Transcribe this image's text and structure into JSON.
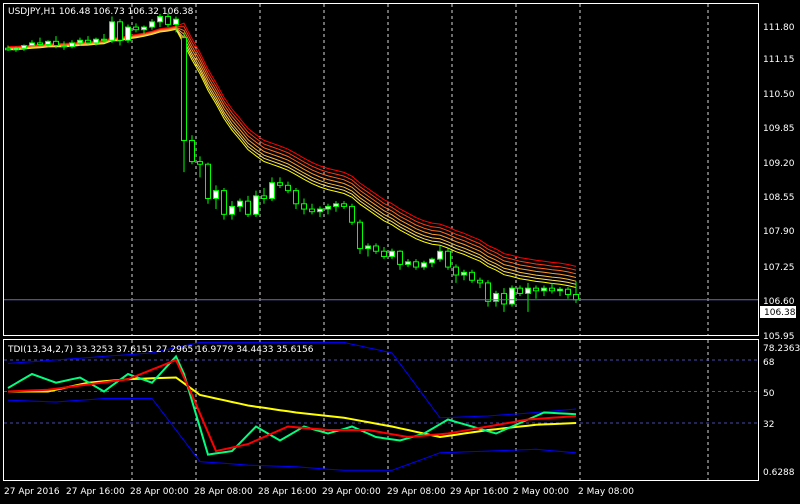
{
  "main_panel": {
    "header": "USDJPY,H1  106.48 106.73 106.32 106.38",
    "price_labels": [
      "111.80",
      "111.15",
      "110.50",
      "109.85",
      "109.20",
      "108.55",
      "107.90",
      "107.25",
      "106.60",
      "105.95"
    ],
    "current_price": "106.38"
  },
  "indicator_panel": {
    "header": "TDI(13,34,2,7) 33.3253 37.6151 27.2965 16.9779 34.4433 35.6156",
    "level_labels": [
      "78.2363",
      "68",
      "50",
      "32",
      "0.6288"
    ]
  },
  "time_labels": [
    "27 Apr 2016",
    "27 Apr 16:00",
    "28 Apr 00:00",
    "28 Apr 08:00",
    "28 Apr 16:00",
    "29 Apr 00:00",
    "29 Apr 08:00",
    "29 Apr 16:00",
    "2 May 00:00",
    "2 May 08:00"
  ],
  "colors": {
    "background": "#000000",
    "frame": "#ffffff",
    "bull_candle": "#ffffff",
    "bear_candle": "#000000",
    "candle_wick": "#00ff00",
    "grid": "#ffffff",
    "current_price_line": "#6b6bb8",
    "ma_ribbon": [
      "#ffff00",
      "#ffe066",
      "#ffc040",
      "#ff9a30",
      "#ff6a20",
      "#ff3a10",
      "#ff0000"
    ],
    "rsi_line": "#00ff7f",
    "signal_line": "#ff0000",
    "market_base": "#ffff00",
    "bands": "#0000ff",
    "level_dash": "#4a4aaa"
  },
  "chart_data": [
    {
      "type": "candlestick",
      "symbol": "USDJPY",
      "timeframe": "H1",
      "open": 106.48,
      "high": 106.73,
      "low": 106.32,
      "close": 106.38,
      "ylim": [
        105.75,
        111.95
      ],
      "candles": [
        [
          111.15,
          111.2,
          111.1,
          111.12
        ],
        [
          111.12,
          111.18,
          111.08,
          111.15
        ],
        [
          111.15,
          111.22,
          111.1,
          111.2
        ],
        [
          111.2,
          111.3,
          111.18,
          111.25
        ],
        [
          111.25,
          111.35,
          111.2,
          111.22
        ],
        [
          111.22,
          111.3,
          111.18,
          111.28
        ],
        [
          111.28,
          111.38,
          111.15,
          111.2
        ],
        [
          111.2,
          111.28,
          111.12,
          111.18
        ],
        [
          111.18,
          111.3,
          111.15,
          111.25
        ],
        [
          111.25,
          111.35,
          111.2,
          111.3
        ],
        [
          111.3,
          111.38,
          111.22,
          111.25
        ],
        [
          111.25,
          111.35,
          111.2,
          111.32
        ],
        [
          111.32,
          111.42,
          111.25,
          111.3
        ],
        [
          111.3,
          111.75,
          111.25,
          111.65
        ],
        [
          111.65,
          111.7,
          111.2,
          111.3
        ],
        [
          111.3,
          111.6,
          111.25,
          111.55
        ],
        [
          111.55,
          111.62,
          111.45,
          111.5
        ],
        [
          111.5,
          111.58,
          111.42,
          111.55
        ],
        [
          111.55,
          111.7,
          111.5,
          111.65
        ],
        [
          111.65,
          111.8,
          111.55,
          111.75
        ],
        [
          111.75,
          111.82,
          111.55,
          111.6
        ],
        [
          111.6,
          111.75,
          111.45,
          111.7
        ],
        [
          111.35,
          111.45,
          108.8,
          109.4
        ],
        [
          109.4,
          109.5,
          108.95,
          109.0
        ],
        [
          109.0,
          109.1,
          108.7,
          108.95
        ],
        [
          108.95,
          108.98,
          108.2,
          108.3
        ],
        [
          108.3,
          108.55,
          108.1,
          108.45
        ],
        [
          108.45,
          108.5,
          107.9,
          108.0
        ],
        [
          108.0,
          108.25,
          107.9,
          108.15
        ],
        [
          108.15,
          108.3,
          108.05,
          108.25
        ],
        [
          108.25,
          108.35,
          107.95,
          108.0
        ],
        [
          108.0,
          108.45,
          107.95,
          108.35
        ],
        [
          108.35,
          108.5,
          108.2,
          108.3
        ],
        [
          108.3,
          108.7,
          108.25,
          108.6
        ],
        [
          108.6,
          108.7,
          108.5,
          108.55
        ],
        [
          108.55,
          108.62,
          108.4,
          108.45
        ],
        [
          108.45,
          108.5,
          108.1,
          108.2
        ],
        [
          108.2,
          108.3,
          108.0,
          108.1
        ],
        [
          108.1,
          108.2,
          108.0,
          108.05
        ],
        [
          108.05,
          108.15,
          107.95,
          108.1
        ],
        [
          108.1,
          108.2,
          108.0,
          108.15
        ],
        [
          108.15,
          108.25,
          108.05,
          108.2
        ],
        [
          108.2,
          108.25,
          108.1,
          108.15
        ],
        [
          108.15,
          108.2,
          107.8,
          107.85
        ],
        [
          107.85,
          107.9,
          107.25,
          107.35
        ],
        [
          107.35,
          107.45,
          107.2,
          107.4
        ],
        [
          107.4,
          107.45,
          107.25,
          107.3
        ],
        [
          107.3,
          107.38,
          107.15,
          107.2
        ],
        [
          107.2,
          107.35,
          107.15,
          107.3
        ],
        [
          107.3,
          107.32,
          106.95,
          107.05
        ],
        [
          107.05,
          107.15,
          107.0,
          107.1
        ],
        [
          107.1,
          107.15,
          106.95,
          107.0
        ],
        [
          107.0,
          107.12,
          106.95,
          107.08
        ],
        [
          107.08,
          107.18,
          107.0,
          107.15
        ],
        [
          107.15,
          107.4,
          107.1,
          107.3
        ],
        [
          107.3,
          107.35,
          106.95,
          107.0
        ],
        [
          107.0,
          107.05,
          106.7,
          106.85
        ],
        [
          106.85,
          106.95,
          106.75,
          106.9
        ],
        [
          106.9,
          106.95,
          106.7,
          106.75
        ],
        [
          106.75,
          106.8,
          106.6,
          106.7
        ],
        [
          106.7,
          106.75,
          106.25,
          106.35
        ],
        [
          106.35,
          106.55,
          106.25,
          106.5
        ],
        [
          106.5,
          106.6,
          106.15,
          106.3
        ],
        [
          106.3,
          106.65,
          106.25,
          106.6
        ],
        [
          106.6,
          106.65,
          106.45,
          106.5
        ],
        [
          106.5,
          106.7,
          106.15,
          106.6
        ],
        [
          106.6,
          106.65,
          106.4,
          106.55
        ],
        [
          106.55,
          106.65,
          106.45,
          106.6
        ],
        [
          106.6,
          106.7,
          106.5,
          106.55
        ],
        [
          106.55,
          106.62,
          106.45,
          106.58
        ],
        [
          106.58,
          106.62,
          106.4,
          106.48
        ],
        [
          106.48,
          106.73,
          106.32,
          106.38
        ]
      ],
      "ma_ribbon_offsets": [
        0.0,
        0.06,
        0.12,
        0.19,
        0.26,
        0.33,
        0.4
      ]
    },
    {
      "type": "line",
      "name": "TDI(13,34,2,7)",
      "ylim": [
        0.6288,
        78.2363
      ],
      "levels": [
        68,
        50,
        32
      ],
      "n": 72,
      "series": [
        {
          "key": "rsi",
          "keys_x": [
            0,
            3,
            6,
            9,
            12,
            15,
            18,
            21,
            22,
            25,
            28,
            31,
            34,
            37,
            40,
            43,
            46,
            49,
            52,
            55,
            58,
            61,
            64,
            67,
            71
          ],
          "values": [
            52,
            60,
            55,
            58,
            50,
            60,
            55,
            70,
            60,
            14,
            16,
            30,
            22,
            30,
            26,
            30,
            24,
            22,
            26,
            34,
            30,
            26,
            32,
            38,
            37
          ]
        },
        {
          "key": "signal",
          "keys_x": [
            0,
            5,
            10,
            15,
            21,
            23,
            26,
            30,
            35,
            40,
            45,
            50,
            55,
            60,
            65,
            71
          ],
          "values": [
            50,
            51,
            54,
            57,
            68,
            48,
            16,
            20,
            30,
            28,
            28,
            24,
            26,
            30,
            34,
            36
          ]
        },
        {
          "key": "base",
          "keys_x": [
            0,
            5,
            10,
            15,
            21,
            24,
            30,
            36,
            42,
            48,
            54,
            60,
            66,
            71
          ],
          "values": [
            50,
            50,
            55,
            57,
            58,
            48,
            42,
            38,
            35,
            30,
            24,
            28,
            31,
            32
          ]
        },
        {
          "key": "upper_band",
          "keys_x": [
            0,
            6,
            12,
            18,
            24,
            30,
            36,
            42,
            48,
            54,
            60,
            66,
            71
          ],
          "values": [
            66,
            68,
            70,
            72,
            78,
            78,
            78,
            78,
            72,
            35,
            36,
            38,
            40
          ]
        },
        {
          "key": "lower_band",
          "keys_x": [
            0,
            6,
            12,
            18,
            24,
            30,
            36,
            42,
            48,
            54,
            60,
            66,
            71
          ],
          "values": [
            45,
            44,
            46,
            46,
            10,
            8,
            7,
            5,
            5,
            15,
            16,
            17,
            15
          ]
        }
      ]
    }
  ]
}
